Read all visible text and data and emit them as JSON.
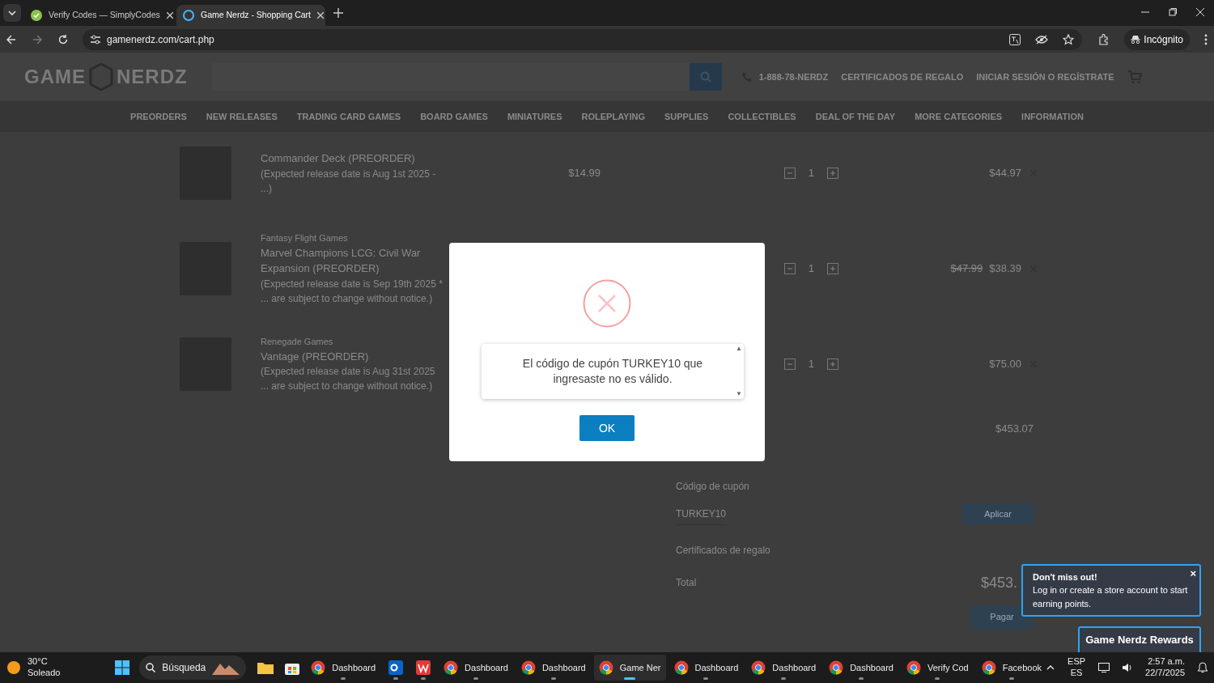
{
  "browser": {
    "tabs": [
      {
        "title": "Verify Codes — SimplyCodes",
        "selected": false
      },
      {
        "title": "Game Nerdz - Shopping Cart",
        "selected": true
      }
    ],
    "url": "gamenerdz.com/cart.php",
    "profile": "Incógnito"
  },
  "header": {
    "logo_left": "GAME",
    "logo_right": "NERDZ",
    "phone": "1-888-78-NERDZ",
    "links": [
      "CERTIFICADOS DE REGALO",
      "INICIAR SESIÓN O REGÍSTRATE"
    ]
  },
  "nav": [
    "PREORDERS",
    "NEW RELEASES",
    "TRADING CARD GAMES",
    "BOARD GAMES",
    "MINIATURES",
    "ROLEPLAYING",
    "SUPPLIES",
    "COLLECTIBLES",
    "DEAL OF THE DAY",
    "MORE CATEGORIES",
    "INFORMATION"
  ],
  "cart": [
    {
      "title": "Commander Deck (PREORDER)",
      "note": "(Expected release date is Aug 1st 2025 - ...)",
      "unit_price": "$14.99",
      "qty": "1",
      "price": "$44.97"
    },
    {
      "brand": "Fantasy Flight Games",
      "title": "Marvel Champions LCG: Civil War Expansion (PREORDER)",
      "note": "(Expected release date is Sep 19th 2025 * ... are subject to change without notice.)",
      "qty": "1",
      "original_price": "$47.99",
      "price": "$38.39"
    },
    {
      "brand": "Renegade Games",
      "title": "Vantage (PREORDER)",
      "note": "(Expected release date is Aug 31st 2025 ... are subject to change without notice.)",
      "qty": "1",
      "price": "$75.00"
    }
  ],
  "summary": {
    "subtotal": "$453.07",
    "coupon_label": "Código de cupón",
    "coupon_value": "TURKEY10",
    "apply": "Aplicar",
    "gift_label": "Certificados de regalo",
    "total_label": "Total",
    "total": "$453.",
    "checkout": "Pagar"
  },
  "dialog": {
    "message": "El código de cupón TURKEY10 que ingresaste no es válido.",
    "ok": "OK",
    "scroll_up": "▲",
    "scroll_down": "▼"
  },
  "rewards": {
    "title": "Don't miss out!",
    "text": "Log in or create a store account to start earning points.",
    "close": "×",
    "button": "Game Nerdz Rewards"
  },
  "taskbar": {
    "weather_temp": "30°C",
    "weather_text": "Soleado",
    "search": "Búsqueda",
    "apps": [
      {
        "kind": "chrome",
        "label": "Dashboard",
        "selected": false
      },
      {
        "kind": "outlook",
        "selected": false
      },
      {
        "kind": "wps",
        "selected": false
      },
      {
        "kind": "chrome",
        "label": "Dashboard",
        "selected": false
      },
      {
        "kind": "chrome",
        "label": "Dashboard",
        "selected": false
      },
      {
        "kind": "chrome",
        "label": "Game Ner",
        "selected": true
      },
      {
        "kind": "chrome",
        "label": "Dashboard",
        "selected": false
      },
      {
        "kind": "chrome",
        "label": "Dashboard",
        "selected": false
      },
      {
        "kind": "chrome",
        "label": "Dashboard",
        "selected": false
      },
      {
        "kind": "chrome",
        "label": "Verify Cod",
        "selected": false
      },
      {
        "kind": "chrome",
        "label": "Facebook",
        "selected": false
      }
    ],
    "lang": "ESP",
    "lang_sub": "ES",
    "time": "2:57 a.m.",
    "date": "22/7/2025"
  }
}
